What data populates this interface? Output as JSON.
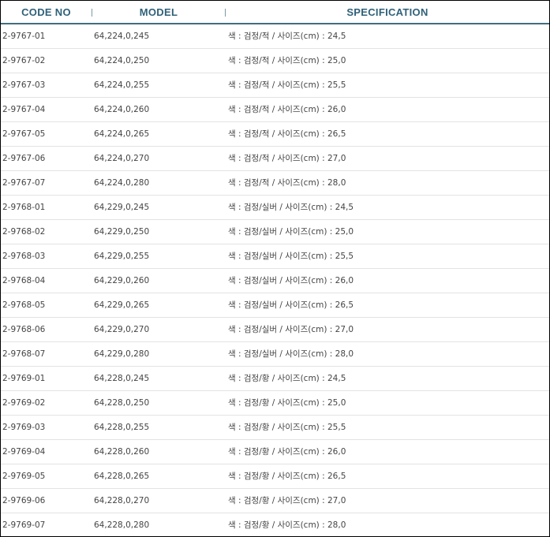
{
  "header": {
    "code_no": "CODE NO",
    "model": "MODEL",
    "specification": "SPECIFICATION"
  },
  "rows": [
    {
      "code": "2-9767-01",
      "model": "64,224,0,245",
      "spec": "색 : 검정/적 / 사이즈(cm) : 24,5"
    },
    {
      "code": "2-9767-02",
      "model": "64,224,0,250",
      "spec": "색 : 검정/적 / 사이즈(cm) : 25,0"
    },
    {
      "code": "2-9767-03",
      "model": "64,224,0,255",
      "spec": "색 : 검정/적 / 사이즈(cm) : 25,5"
    },
    {
      "code": "2-9767-04",
      "model": "64,224,0,260",
      "spec": "색 : 검정/적 / 사이즈(cm) : 26,0"
    },
    {
      "code": "2-9767-05",
      "model": "64,224,0,265",
      "spec": "색 : 검정/적 / 사이즈(cm) : 26,5"
    },
    {
      "code": "2-9767-06",
      "model": "64,224,0,270",
      "spec": "색 : 검정/적 / 사이즈(cm) : 27,0"
    },
    {
      "code": "2-9767-07",
      "model": "64,224,0,280",
      "spec": "색 : 검정/적 / 사이즈(cm) : 28,0"
    },
    {
      "code": "2-9768-01",
      "model": "64,229,0,245",
      "spec": "색 : 검정/실버 / 사이즈(cm) : 24,5"
    },
    {
      "code": "2-9768-02",
      "model": "64,229,0,250",
      "spec": "색 : 검정/실버 / 사이즈(cm) : 25,0"
    },
    {
      "code": "2-9768-03",
      "model": "64,229,0,255",
      "spec": "색 : 검정/실버 / 사이즈(cm) : 25,5"
    },
    {
      "code": "2-9768-04",
      "model": "64,229,0,260",
      "spec": "색 : 검정/실버 / 사이즈(cm) : 26,0"
    },
    {
      "code": "2-9768-05",
      "model": "64,229,0,265",
      "spec": "색 : 검정/실버 / 사이즈(cm) : 26,5"
    },
    {
      "code": "2-9768-06",
      "model": "64,229,0,270",
      "spec": "색 : 검정/실버 / 사이즈(cm) : 27,0"
    },
    {
      "code": "2-9768-07",
      "model": "64,229,0,280",
      "spec": "색 : 검정/실버 / 사이즈(cm) : 28,0"
    },
    {
      "code": "2-9769-01",
      "model": "64,228,0,245",
      "spec": "색 : 검정/황 / 사이즈(cm) : 24,5"
    },
    {
      "code": "2-9769-02",
      "model": "64,228,0,250",
      "spec": "색 : 검정/황 / 사이즈(cm) : 25,0"
    },
    {
      "code": "2-9769-03",
      "model": "64,228,0,255",
      "spec": "색 : 검정/황 / 사이즈(cm) : 25,5"
    },
    {
      "code": "2-9769-04",
      "model": "64,228,0,260",
      "spec": "색 : 검정/황 / 사이즈(cm) : 26,0"
    },
    {
      "code": "2-9769-05",
      "model": "64,228,0,265",
      "spec": "색 : 검정/황 / 사이즈(cm) : 26,5"
    },
    {
      "code": "2-9769-06",
      "model": "64,228,0,270",
      "spec": "색 : 검정/황 / 사이즈(cm) : 27,0"
    },
    {
      "code": "2-9769-07",
      "model": "64,228,0,280",
      "spec": "색 : 검정/황 / 사이즈(cm) : 28,0"
    }
  ]
}
